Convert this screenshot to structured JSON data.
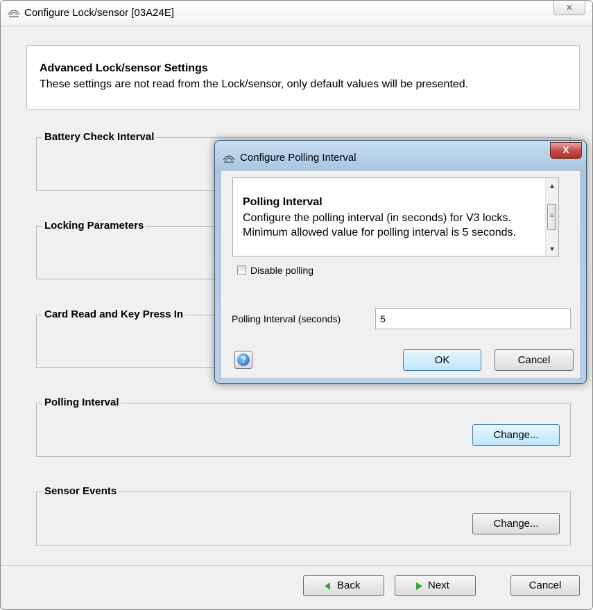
{
  "window": {
    "title": "Configure Lock/sensor [03A24E]",
    "close_label": "⨯"
  },
  "header": {
    "title": "Advanced Lock/sensor Settings",
    "description": "These settings are not read from the Lock/sensor, only default values will be presented."
  },
  "groups": [
    {
      "label": "Battery Check Interval"
    },
    {
      "label": "Locking Parameters"
    },
    {
      "label": "Card Read and Key Press In"
    },
    {
      "label": "Polling Interval",
      "button": "Change..."
    },
    {
      "label": "Sensor Events",
      "button": "Change..."
    }
  ],
  "footer": {
    "back_label": "Back",
    "next_label": "Next",
    "cancel_label": "Cancel"
  },
  "dialog": {
    "title": "Configure Polling Interval",
    "close_label": "X",
    "info_title": "Polling Interval",
    "info_text": "Configure the polling interval (in seconds) for V3 locks. Minimum allowed value for polling interval is 5 seconds.",
    "disable_polling_label": "Disable polling",
    "disable_polling_checked": false,
    "interval_label": "Polling Interval (seconds)",
    "interval_value": "5",
    "ok_label": "OK",
    "cancel_label": "Cancel"
  },
  "icons": [
    "app-icon",
    "close-icon",
    "help-icon",
    "back-arrow-icon",
    "next-arrow-icon",
    "scroll-up-icon",
    "scroll-down-icon"
  ],
  "colors": {
    "window_bg": "#f0f0f0",
    "dialog_frame": "#b8d1ea",
    "close_red": "#c75050",
    "arrow_green": "#3aa53a",
    "hover_button": "#bee6fd"
  }
}
